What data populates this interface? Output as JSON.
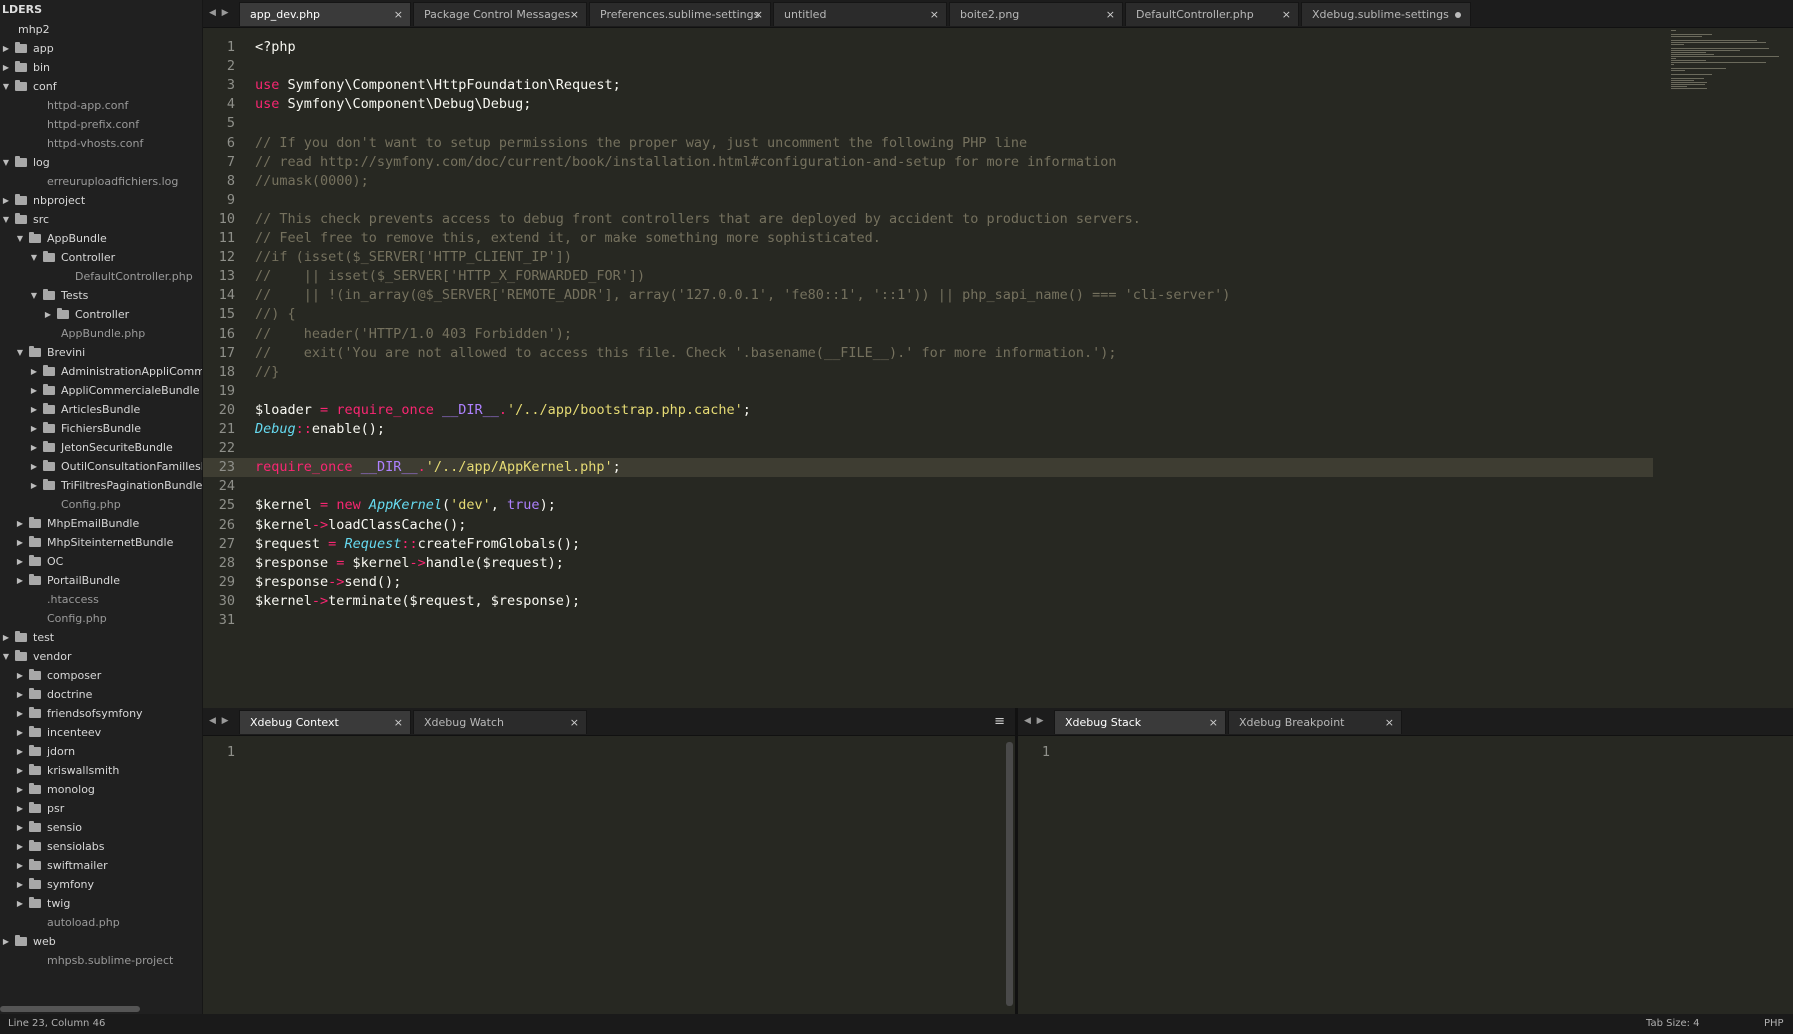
{
  "sidebar": {
    "header": "LDERS",
    "items": [
      {
        "label": "mhp2",
        "depth": 0,
        "kind": "root"
      },
      {
        "label": "app",
        "depth": 0,
        "kind": "folder-closed"
      },
      {
        "label": "bin",
        "depth": 0,
        "kind": "folder-closed"
      },
      {
        "label": "conf",
        "depth": 0,
        "kind": "folder-open"
      },
      {
        "label": "httpd-app.conf",
        "depth": 1,
        "kind": "file"
      },
      {
        "label": "httpd-prefix.conf",
        "depth": 1,
        "kind": "file"
      },
      {
        "label": "httpd-vhosts.conf",
        "depth": 1,
        "kind": "file"
      },
      {
        "label": "log",
        "depth": 0,
        "kind": "folder-open"
      },
      {
        "label": "erreuruploadfichiers.log",
        "depth": 1,
        "kind": "file"
      },
      {
        "label": "nbproject",
        "depth": 0,
        "kind": "folder-closed"
      },
      {
        "label": "src",
        "depth": 0,
        "kind": "folder-open"
      },
      {
        "label": "AppBundle",
        "depth": 1,
        "kind": "folder-open"
      },
      {
        "label": "Controller",
        "depth": 2,
        "kind": "folder-open"
      },
      {
        "label": "DefaultController.php",
        "depth": 3,
        "kind": "file"
      },
      {
        "label": "Tests",
        "depth": 2,
        "kind": "folder-open"
      },
      {
        "label": "Controller",
        "depth": 3,
        "kind": "folder-closed"
      },
      {
        "label": "AppBundle.php",
        "depth": 2,
        "kind": "file"
      },
      {
        "label": "Brevini",
        "depth": 1,
        "kind": "folder-open"
      },
      {
        "label": "AdministrationAppliComme",
        "depth": 2,
        "kind": "folder-closed"
      },
      {
        "label": "AppliCommercialeBundle",
        "depth": 2,
        "kind": "folder-closed"
      },
      {
        "label": "ArticlesBundle",
        "depth": 2,
        "kind": "folder-closed"
      },
      {
        "label": "FichiersBundle",
        "depth": 2,
        "kind": "folder-closed"
      },
      {
        "label": "JetonSecuriteBundle",
        "depth": 2,
        "kind": "folder-closed"
      },
      {
        "label": "OutilConsultationFamillesE",
        "depth": 2,
        "kind": "folder-closed"
      },
      {
        "label": "TriFiltresPaginationBundle",
        "depth": 2,
        "kind": "folder-closed"
      },
      {
        "label": "Config.php",
        "depth": 2,
        "kind": "file"
      },
      {
        "label": "MhpEmailBundle",
        "depth": 1,
        "kind": "folder-closed"
      },
      {
        "label": "MhpSiteinternetBundle",
        "depth": 1,
        "kind": "folder-closed"
      },
      {
        "label": "OC",
        "depth": 1,
        "kind": "folder-closed"
      },
      {
        "label": "PortailBundle",
        "depth": 1,
        "kind": "folder-closed"
      },
      {
        "label": ".htaccess",
        "depth": 1,
        "kind": "file"
      },
      {
        "label": "Config.php",
        "depth": 1,
        "kind": "file"
      },
      {
        "label": "test",
        "depth": 0,
        "kind": "folder-closed"
      },
      {
        "label": "vendor",
        "depth": 0,
        "kind": "folder-open"
      },
      {
        "label": "composer",
        "depth": 1,
        "kind": "folder-closed"
      },
      {
        "label": "doctrine",
        "depth": 1,
        "kind": "folder-closed"
      },
      {
        "label": "friendsofsymfony",
        "depth": 1,
        "kind": "folder-closed"
      },
      {
        "label": "incenteev",
        "depth": 1,
        "kind": "folder-closed"
      },
      {
        "label": "jdorn",
        "depth": 1,
        "kind": "folder-closed"
      },
      {
        "label": "kriswallsmith",
        "depth": 1,
        "kind": "folder-closed"
      },
      {
        "label": "monolog",
        "depth": 1,
        "kind": "folder-closed"
      },
      {
        "label": "psr",
        "depth": 1,
        "kind": "folder-closed"
      },
      {
        "label": "sensio",
        "depth": 1,
        "kind": "folder-closed"
      },
      {
        "label": "sensiolabs",
        "depth": 1,
        "kind": "folder-closed"
      },
      {
        "label": "swiftmailer",
        "depth": 1,
        "kind": "folder-closed"
      },
      {
        "label": "symfony",
        "depth": 1,
        "kind": "folder-closed"
      },
      {
        "label": "twig",
        "depth": 1,
        "kind": "folder-closed"
      },
      {
        "label": "autoload.php",
        "depth": 1,
        "kind": "file"
      },
      {
        "label": "web",
        "depth": 0,
        "kind": "folder-closed"
      },
      {
        "label": "mhpsb.sublime-project",
        "depth": 1,
        "kind": "file"
      }
    ]
  },
  "tabs": [
    {
      "label": "app_dev.php",
      "active": true,
      "marker": "×"
    },
    {
      "label": "Package Control Messages",
      "active": false,
      "marker": "×"
    },
    {
      "label": "Preferences.sublime-settings",
      "active": false,
      "marker": "×"
    },
    {
      "label": "untitled",
      "active": false,
      "marker": "×"
    },
    {
      "label": "boite2.png",
      "active": false,
      "marker": "×"
    },
    {
      "label": "DefaultController.php",
      "active": false,
      "marker": "×"
    },
    {
      "label": "Xdebug.sublime-settings",
      "active": false,
      "marker": "dot"
    }
  ],
  "editor": {
    "current_line": 23,
    "lines": [
      [
        [
          "t",
          "<?php"
        ]
      ],
      [],
      [
        [
          "k",
          "use"
        ],
        [
          "t",
          " Symfony\\Component\\HttpFoundation\\Request;"
        ]
      ],
      [
        [
          "k",
          "use"
        ],
        [
          "t",
          " Symfony\\Component\\Debug\\Debug;"
        ]
      ],
      [],
      [
        [
          "c",
          "// If you don't want to setup permissions the proper way, just uncomment the following PHP line"
        ]
      ],
      [
        [
          "c",
          "// read http://symfony.com/doc/current/book/installation.html#configuration-and-setup for more information"
        ]
      ],
      [
        [
          "c",
          "//umask(0000);"
        ]
      ],
      [],
      [
        [
          "c",
          "// This check prevents access to debug front controllers that are deployed by accident to production servers."
        ]
      ],
      [
        [
          "c",
          "// Feel free to remove this, extend it, or make something more sophisticated."
        ]
      ],
      [
        [
          "c",
          "//if (isset($_SERVER['HTTP_CLIENT_IP'])"
        ]
      ],
      [
        [
          "c",
          "//    || isset($_SERVER['HTTP_X_FORWARDED_FOR'])"
        ]
      ],
      [
        [
          "c",
          "//    || !(in_array(@$_SERVER['REMOTE_ADDR'], array('127.0.0.1', 'fe80::1', '::1')) || php_sapi_name() === 'cli-server')"
        ]
      ],
      [
        [
          "c",
          "//) {"
        ]
      ],
      [
        [
          "c",
          "//    header('HTTP/1.0 403 Forbidden');"
        ]
      ],
      [
        [
          "c",
          "//    exit('You are not allowed to access this file. Check '.basename(__FILE__).' for more information.');"
        ]
      ],
      [
        [
          "c",
          "//}"
        ]
      ],
      [],
      [
        [
          "t",
          "$loader "
        ],
        [
          "k",
          "="
        ],
        [
          "t",
          " "
        ],
        [
          "k",
          "require_once"
        ],
        [
          "t",
          " "
        ],
        [
          "p",
          "__DIR__"
        ],
        [
          "k",
          "."
        ],
        [
          "s",
          "'/../app/bootstrap.php.cache'"
        ],
        [
          "t",
          ";"
        ]
      ],
      [
        [
          "i",
          "Debug"
        ],
        [
          "k",
          "::"
        ],
        [
          "t",
          "enable();"
        ]
      ],
      [],
      [
        [
          "k",
          "require_once"
        ],
        [
          "t",
          " "
        ],
        [
          "p",
          "__DIR__"
        ],
        [
          "k",
          "."
        ],
        [
          "s",
          "'/../app/AppKernel.php'"
        ],
        [
          "t",
          ";"
        ]
      ],
      [],
      [
        [
          "t",
          "$kernel "
        ],
        [
          "k",
          "="
        ],
        [
          "t",
          " "
        ],
        [
          "k",
          "new"
        ],
        [
          "t",
          " "
        ],
        [
          "i",
          "AppKernel"
        ],
        [
          "t",
          "("
        ],
        [
          "s",
          "'dev'"
        ],
        [
          "t",
          ", "
        ],
        [
          "p",
          "true"
        ],
        [
          "t",
          ");"
        ]
      ],
      [
        [
          "t",
          "$kernel"
        ],
        [
          "k",
          "->"
        ],
        [
          "t",
          "loadClassCache();"
        ]
      ],
      [
        [
          "t",
          "$request "
        ],
        [
          "k",
          "="
        ],
        [
          "t",
          " "
        ],
        [
          "i",
          "Request"
        ],
        [
          "k",
          "::"
        ],
        [
          "t",
          "createFromGlobals();"
        ]
      ],
      [
        [
          "t",
          "$response "
        ],
        [
          "k",
          "="
        ],
        [
          "t",
          " $kernel"
        ],
        [
          "k",
          "->"
        ],
        [
          "t",
          "handle($request);"
        ]
      ],
      [
        [
          "t",
          "$response"
        ],
        [
          "k",
          "->"
        ],
        [
          "t",
          "send();"
        ]
      ],
      [
        [
          "t",
          "$kernel"
        ],
        [
          "k",
          "->"
        ],
        [
          "t",
          "terminate($request, $response);"
        ]
      ],
      []
    ]
  },
  "panels": {
    "left_tabs": [
      {
        "label": "Xdebug Context",
        "active": true,
        "marker": "×"
      },
      {
        "label": "Xdebug Watch",
        "active": false,
        "marker": "×"
      }
    ],
    "left_menu_icon": "≡",
    "right_tabs": [
      {
        "label": "Xdebug Stack",
        "active": true,
        "marker": "×"
      },
      {
        "label": "Xdebug Breakpoint",
        "active": false,
        "marker": "×"
      }
    ],
    "left_line_number": "1",
    "right_line_number": "1"
  },
  "nav": {
    "prev": "◀",
    "next": "▶"
  },
  "status": {
    "position": "Line 23, Column 46",
    "tab_size": "Tab Size: 4",
    "syntax": "PHP"
  },
  "icons": {
    "close": "close-icon",
    "dirty": "unsaved-dot-icon",
    "menu": "menu-icon",
    "folder": "folder-icon",
    "arrow": "disclosure-arrow-icon"
  }
}
